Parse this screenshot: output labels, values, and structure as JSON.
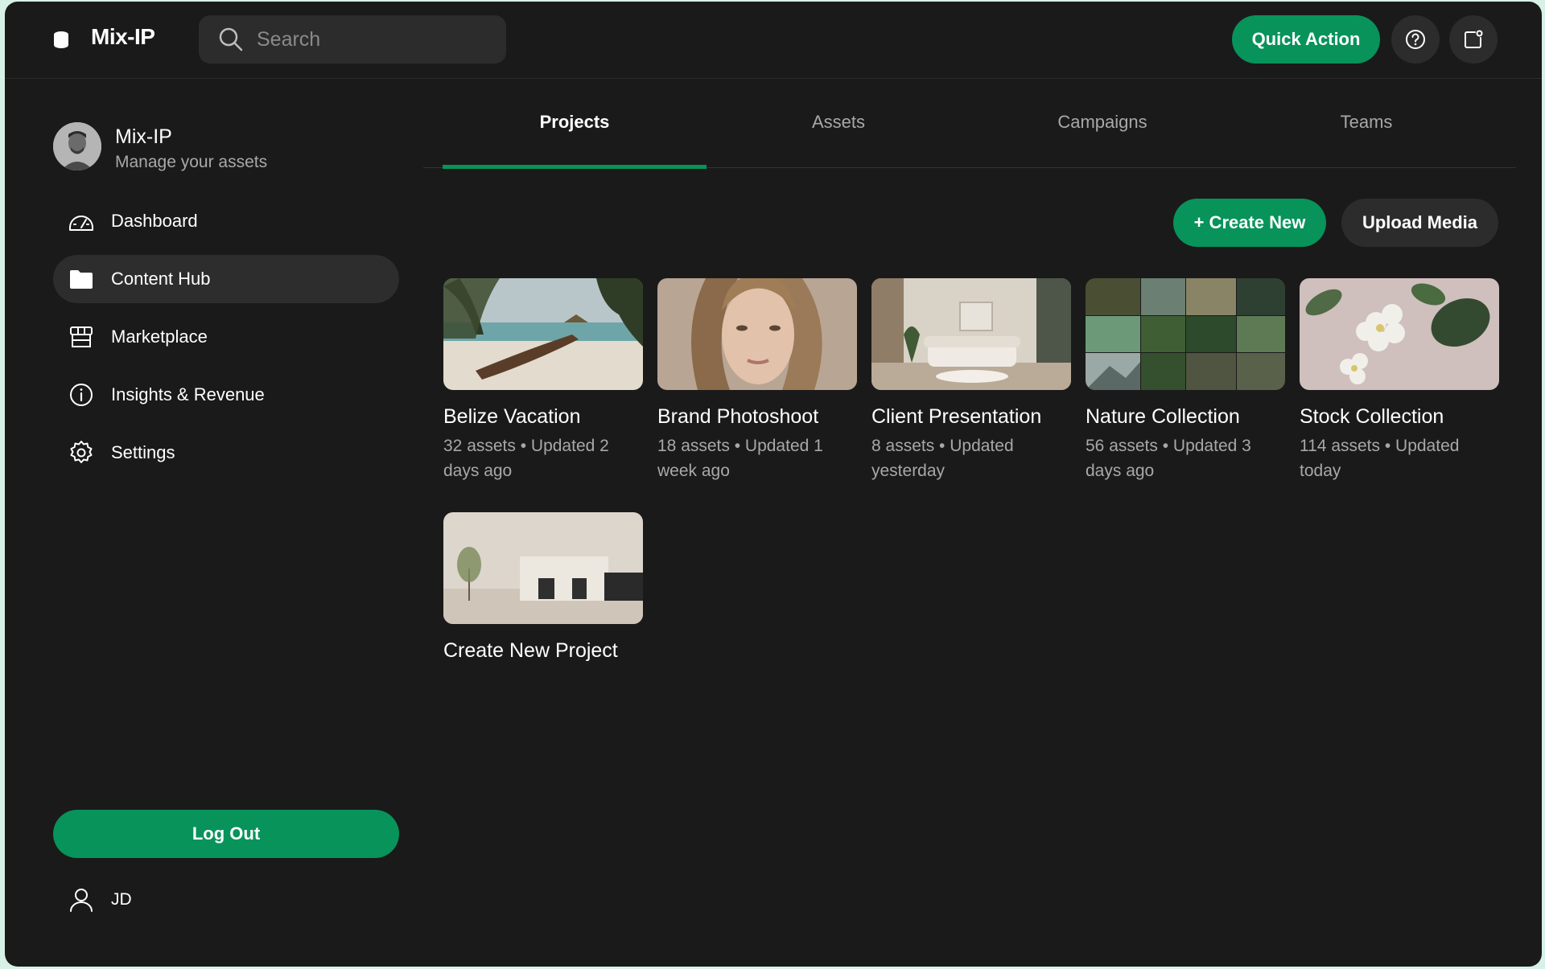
{
  "app": {
    "name": "Mix-IP"
  },
  "search": {
    "placeholder": "Search"
  },
  "header": {
    "quick_action_label": "Quick Action"
  },
  "profile": {
    "name": "Mix-IP",
    "subtitle": "Manage your assets"
  },
  "sidebar": {
    "items": [
      {
        "label": "Dashboard",
        "icon": "dashboard-icon"
      },
      {
        "label": "Content Hub",
        "icon": "folder-icon",
        "active": true
      },
      {
        "label": "Marketplace",
        "icon": "store-icon"
      },
      {
        "label": "Insights & Revenue",
        "icon": "info-icon"
      },
      {
        "label": "Settings",
        "icon": "gear-icon"
      }
    ],
    "logout_label": "Log Out",
    "user_label": "JD"
  },
  "tabs": [
    {
      "label": "Projects",
      "active": true
    },
    {
      "label": "Assets"
    },
    {
      "label": "Campaigns"
    },
    {
      "label": "Teams"
    }
  ],
  "actions": {
    "create_label": "+ Create New",
    "upload_label": "Upload Media"
  },
  "projects": [
    {
      "title": "Belize Vacation",
      "meta": "32 assets • Updated 2 days ago"
    },
    {
      "title": "Brand Photoshoot",
      "meta": "18 assets • Updated 1 week ago"
    },
    {
      "title": "Client Presentation",
      "meta": "8 assets • Updated yesterday"
    },
    {
      "title": "Nature Collection",
      "meta": "56 assets • Updated 3 days ago"
    },
    {
      "title": "Stock Collection",
      "meta": "114 assets • Updated today"
    },
    {
      "title": "Create New Project",
      "meta": ""
    }
  ],
  "colors": {
    "accent": "#07935a",
    "background": "#1a1a1a",
    "surface": "#2c2c2c",
    "frame": "#d8f1e6"
  }
}
